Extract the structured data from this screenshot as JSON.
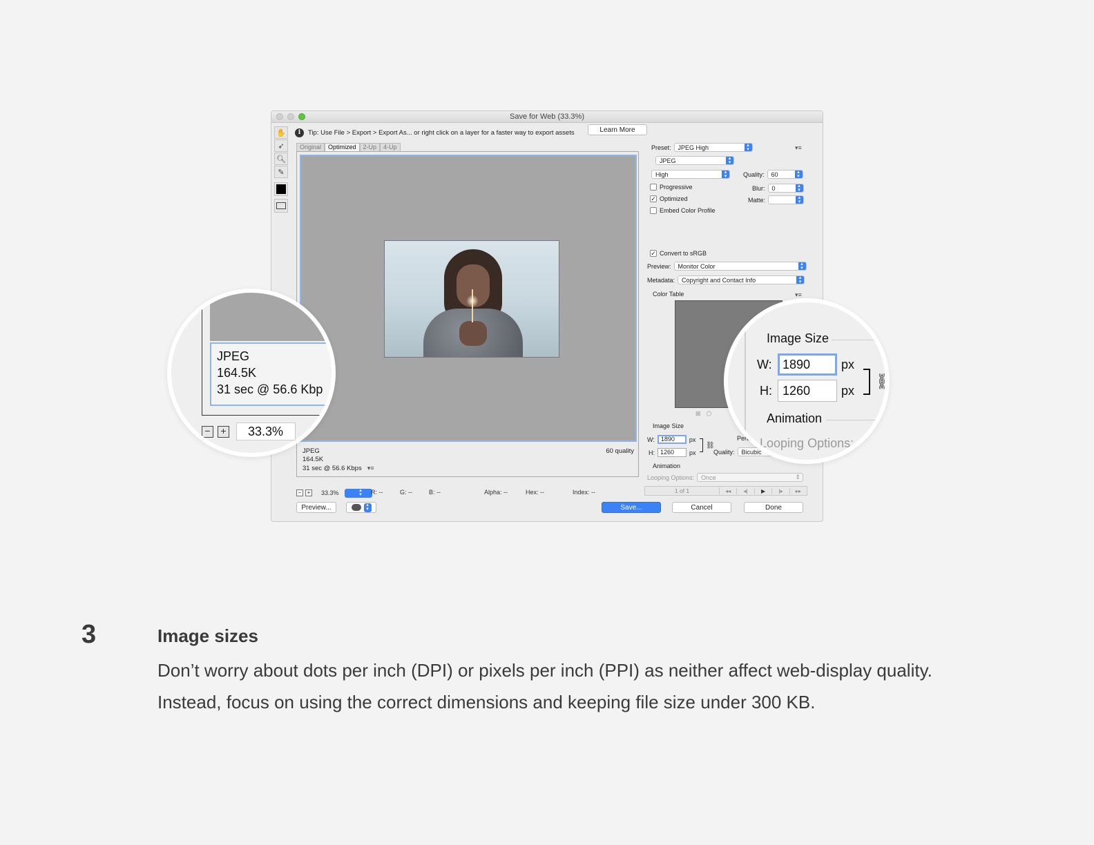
{
  "window": {
    "title": "Save for Web (33.3%)",
    "tip": "Tip: Use File > Export > Export As...  or right click on a layer for a faster way to export assets",
    "learn_more": "Learn More"
  },
  "tools": [
    "hand-tool-icon",
    "slice-select-tool-icon",
    "zoom-tool-icon",
    "eyedropper-tool-icon"
  ],
  "tabs": [
    "Original",
    "Optimized",
    "2-Up",
    "4-Up"
  ],
  "active_tab": "Optimized",
  "viewport_info": {
    "format": "JPEG",
    "size": "164.5K",
    "time": "31 sec @ 56.6 Kbps",
    "quality": "60 quality"
  },
  "status": {
    "zoom": "33.3%",
    "r": "R: --",
    "g": "G: --",
    "b": "B: --",
    "alpha": "Alpha: --",
    "hex": "Hex: --",
    "index": "Index: --"
  },
  "footer": {
    "preview": "Preview...",
    "save": "Save...",
    "cancel": "Cancel",
    "done": "Done"
  },
  "settings": {
    "preset_label": "Preset:",
    "preset": "JPEG High",
    "format": "JPEG",
    "compression": "High",
    "quality_label": "Quality:",
    "quality": "60",
    "progressive": "Progressive",
    "blur_label": "Blur:",
    "blur": "0",
    "optimized": "Optimized",
    "matte_label": "Matte:",
    "embed_profile": "Embed Color Profile",
    "convert_srgb": "Convert to sRGB",
    "preview_label": "Preview:",
    "preview_value": "Monitor Color",
    "metadata_label": "Metadata:",
    "metadata_value": "Copyright and Contact Info",
    "color_table": "Color Table",
    "image_size": "Image Size",
    "w_label": "W:",
    "width": "1890",
    "h_label": "H:",
    "height": "1260",
    "px": "px",
    "percent_label": "Perc",
    "resample_label": "Quality:",
    "resample_value": "Bicubic",
    "animation": "Animation",
    "looping_label": "Looping Options:",
    "looping_value": "Once",
    "frame_count": "1 of 1",
    "checked": {
      "progressive": false,
      "optimized": true,
      "embed_profile": false,
      "convert_srgb": true
    }
  },
  "magnifier_left": {
    "format": "JPEG",
    "size": "164.5K",
    "time": "31 sec @ 56.6 Kbp",
    "zoom": "33.3%"
  },
  "magnifier_right": {
    "image_size": "Image Size",
    "w_label": "W:",
    "width": "1890",
    "px": "px",
    "h_label": "H:",
    "height": "1260",
    "animation": "Animation",
    "looping": "Looping Options:"
  },
  "caption": {
    "number": "3",
    "title": "Image sizes",
    "body": "Don’t worry about dots per inch (DPI) or pixels per inch (PPI) as neither affect web-display quality.  Instead, focus on using the correct dimensions and keeping file size under 300 KB."
  },
  "colors": {
    "accent": "#3b82f6",
    "focus_ring": "#7aa7f0",
    "canvas_gray": "#a6a6a6"
  }
}
